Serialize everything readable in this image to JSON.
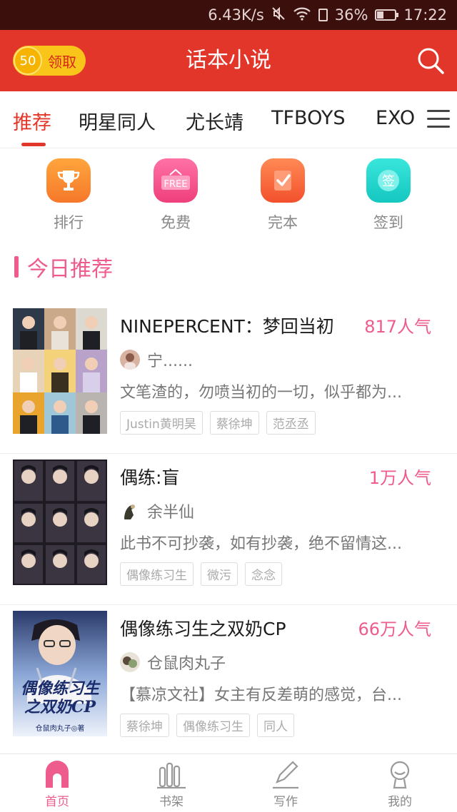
{
  "status_bar": {
    "speed": "6.43K/s",
    "battery": "36%",
    "time": "17:22",
    "battery_level": 0.36
  },
  "header": {
    "coin_value": "50",
    "coin_label": "领取",
    "title": "话本小说"
  },
  "tabs": [
    {
      "label": "推荐",
      "active": true
    },
    {
      "label": "明星同人"
    },
    {
      "label": "尤长靖"
    },
    {
      "label": "TFBOYS"
    },
    {
      "label": "EXO"
    }
  ],
  "quick_actions": [
    {
      "label": "排行",
      "icon": "trophy-icon",
      "color": "#f8872a"
    },
    {
      "label": "免费",
      "icon": "free-sign-icon",
      "color": "#f0508a",
      "icon_text": "FREE"
    },
    {
      "label": "完本",
      "icon": "checkmark-document-icon",
      "color": "#f6633a"
    },
    {
      "label": "签到",
      "icon": "sign-in-icon",
      "color": "#1ed6c8",
      "icon_text": "签"
    }
  ],
  "section": {
    "title": "今日推荐"
  },
  "books": [
    {
      "title": "NINEPERCENT：梦回当初",
      "popularity": "817人气",
      "author": "宁......",
      "description": "文笔渣的，勿喷当初的一切，似乎都为...",
      "tags": [
        "Justin黄明昊",
        "蔡徐坤",
        "范丞丞"
      ]
    },
    {
      "title": "偶练:盲",
      "popularity": "1万人气",
      "author": "余半仙",
      "description": "此书不可抄袭，如有抄袭，绝不留情这...",
      "tags": [
        "偶像练习生",
        "微污",
        "念念"
      ]
    },
    {
      "title": "偶像练习生之双奶CP",
      "popularity": "66万人气",
      "author": "仓鼠肉丸子",
      "description": "【慕凉文社】女主有反差萌的感觉，台...",
      "tags": [
        "蔡徐坤",
        "偶像练习生",
        "同人"
      ],
      "cover_text": "偶像练习生之双奶CP",
      "cover_author": "仓鼠肉丸子◎著"
    }
  ],
  "bottom_nav": [
    {
      "label": "首页",
      "icon": "home-icon",
      "active": true
    },
    {
      "label": "书架",
      "icon": "bookshelf-icon"
    },
    {
      "label": "写作",
      "icon": "pen-icon"
    },
    {
      "label": "我的",
      "icon": "profile-icon"
    }
  ],
  "colors": {
    "brand_red": "#e3362a",
    "accent_pink": "#ee5c8e",
    "coin_yellow": "#f9c51a"
  }
}
